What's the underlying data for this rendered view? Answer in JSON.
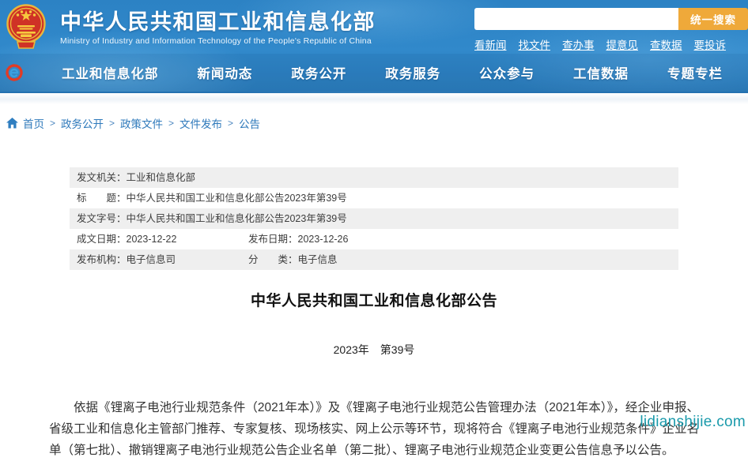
{
  "header": {
    "site_name_zh": "中华人民共和国工业和信息化部",
    "site_name_en": "Ministry of Industry and Information Technology of the People's Republic of China",
    "search_value": "",
    "search_button": "统一搜索",
    "quick_links": [
      "看新闻",
      "找文件",
      "查办事",
      "提意见",
      "查数据",
      "要投诉"
    ]
  },
  "nav": {
    "items": [
      "工业和信息化部",
      "新闻动态",
      "政务公开",
      "政务服务",
      "公众参与",
      "工信数据",
      "专题专栏"
    ]
  },
  "breadcrumb": {
    "separator": ">",
    "items": [
      "首页",
      "政务公开",
      "政策文件",
      "文件发布",
      "公告"
    ]
  },
  "meta_table": {
    "rows": [
      [
        {
          "label": "发文机关：",
          "value": "工业和信息化部"
        }
      ],
      [
        {
          "label": "标　　题：",
          "value": "中华人民共和国工业和信息化部公告2023年第39号"
        }
      ],
      [
        {
          "label": "发文字号：",
          "value": "中华人民共和国工业和信息化部公告2023年第39号"
        }
      ],
      [
        {
          "label": "成文日期：",
          "value": "2023-12-22"
        },
        {
          "label": "发布日期：",
          "value": "2023-12-26"
        }
      ],
      [
        {
          "label": "发布机构：",
          "value": "电子信息司"
        },
        {
          "label": "分　　类：",
          "value": "电子信息"
        }
      ]
    ]
  },
  "article": {
    "title": "中华人民共和国工业和信息化部公告",
    "doc_number": "2023年　第39号",
    "body": "依据《锂离子电池行业规范条件（2021年本）》及《锂离子电池行业规范公告管理办法（2021年本）》，经企业申报、省级工业和信息化主管部门推荐、专家复核、现场核实、网上公示等环节，现将符合《锂离子电池行业规范条件》企业名单（第七批）、撤销锂离子电池行业规范公告企业名单（第二批）、锂离子电池行业规范企业变更公告信息予以公告。"
  },
  "watermark": "lidianshijie.com",
  "colors": {
    "banner_blue": "#2e84c4",
    "search_button_orange": "#efa93a",
    "breadcrumb_blue": "#2e79bb",
    "watermark_teal": "#1a9aab",
    "table_row_gray": "#efefef"
  }
}
